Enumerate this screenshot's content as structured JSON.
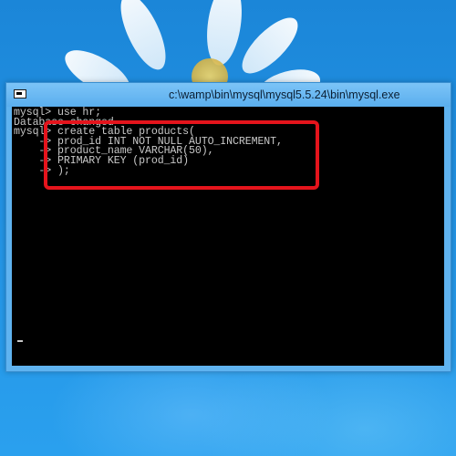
{
  "window": {
    "title": "c:\\wamp\\bin\\mysql\\mysql5.5.24\\bin\\mysql.exe",
    "icon": "console-window-icon"
  },
  "console": {
    "lines": [
      "mysql> use hr;",
      "Database changed",
      "mysql> create table products(",
      "    -> prod_id INT NOT NULL AUTO_INCREMENT,",
      "    -> product_name VARCHAR(50),",
      "    -> PRIMARY KEY (prod_id)",
      "    -> );"
    ]
  },
  "colors": {
    "highlight": "#e4141c",
    "console_bg": "#000000",
    "console_fg": "#c8c8c8",
    "titlebar": "#6bbcf3"
  }
}
